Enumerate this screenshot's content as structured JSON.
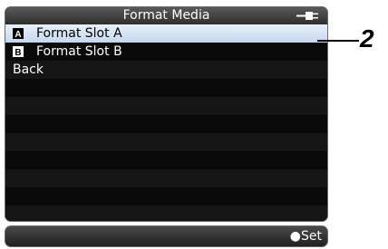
{
  "screen": {
    "title": "Format Media",
    "menu_items": [
      {
        "icon": "A",
        "label": "Format Slot A",
        "selected": true
      },
      {
        "icon": "B",
        "label": "Format Slot B",
        "selected": false
      },
      {
        "icon": "",
        "label": "Back",
        "selected": false
      }
    ],
    "set_label": "●Set"
  },
  "callout": {
    "number": "2"
  },
  "icons": {
    "power": "power-plug-icon",
    "slot_a": "slot-a-icon",
    "slot_b": "slot-b-icon"
  },
  "colors": {
    "selected_row": "#dbe7f6",
    "screen_bg": "#0c0c0c",
    "titlebar": "#3c3c3c"
  }
}
